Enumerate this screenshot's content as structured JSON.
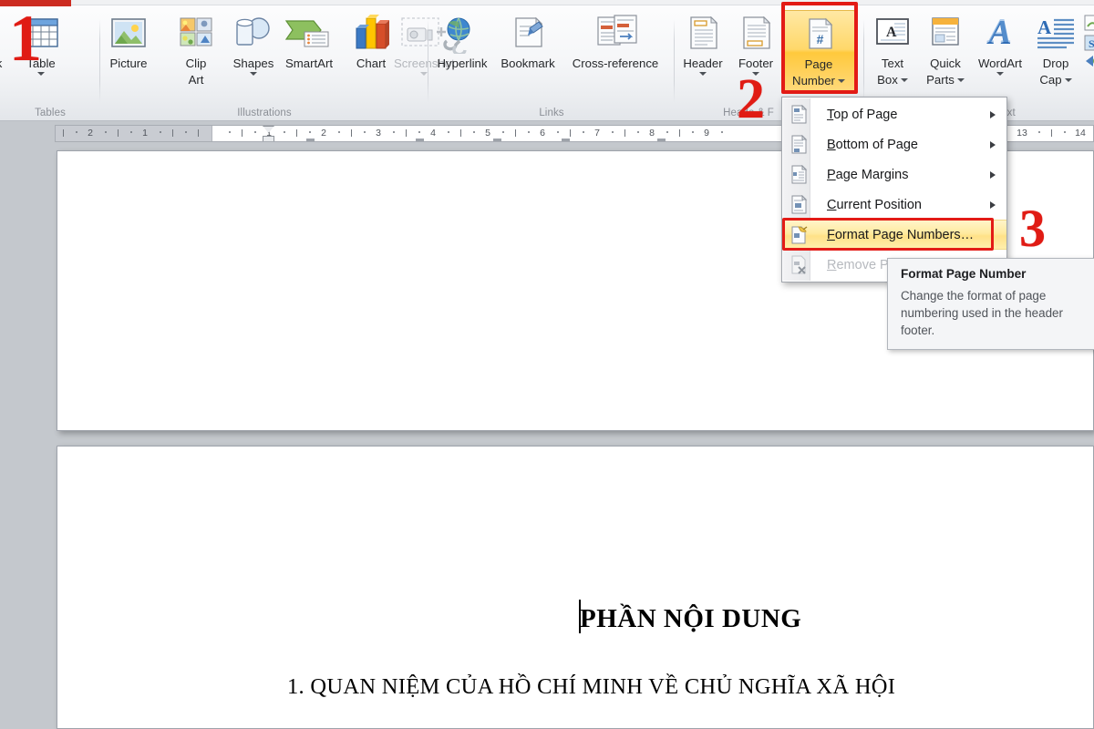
{
  "ribbon": {
    "groups": [
      {
        "name": "tables",
        "title": "Tables"
      },
      {
        "name": "illustrations",
        "title": "Illustrations"
      },
      {
        "name": "links",
        "title": "Links"
      },
      {
        "name": "header_footer",
        "title": "Heade  & F"
      },
      {
        "name": "text",
        "title": "Text"
      }
    ],
    "buttons": {
      "table": "Table",
      "picture": "Picture",
      "clip_art_line1": "Clip",
      "clip_art_line2": "Art",
      "shapes": "Shapes",
      "smartart": "SmartArt",
      "chart": "Chart",
      "screenshot": "Screenshot",
      "hyperlink": "Hyperlink",
      "bookmark": "Bookmark",
      "cross_reference": "Cross-reference",
      "header": "Header",
      "footer": "Footer",
      "page_number_line1": "Page",
      "page_number_line2": "Number",
      "text_box_line1": "Text",
      "text_box_line2": "Box",
      "quick_parts_line1": "Quick",
      "quick_parts_line2": "Parts",
      "wordart": "WordArt",
      "drop_cap_line1": "Drop",
      "drop_cap_line2": "Cap"
    },
    "highlight_color": "#ffd86a",
    "annotation_color": "#e31b16"
  },
  "ruler": {
    "left_margin_ticks": [
      "2",
      "1"
    ],
    "ticks": [
      "1",
      "2",
      "3",
      "4",
      "5",
      "6",
      "7",
      "8",
      "9",
      "13",
      "14"
    ]
  },
  "menu": {
    "name": "page-number-menu",
    "items": [
      {
        "label": "Top of Page",
        "underline": "T",
        "submenu": true,
        "state": "normal",
        "icon": "page-top-number-icon"
      },
      {
        "label": "Bottom of Page",
        "underline": "B",
        "submenu": true,
        "state": "normal",
        "icon": "page-bottom-number-icon"
      },
      {
        "label": "Page Margins",
        "underline": "P",
        "submenu": true,
        "state": "normal",
        "icon": "page-margins-number-icon"
      },
      {
        "label": "Current Position",
        "underline": "C",
        "submenu": true,
        "state": "normal",
        "icon": "page-current-position-icon"
      },
      {
        "label": "Format Page Numbers…",
        "underline": "F",
        "submenu": false,
        "state": "highlighted",
        "icon": "format-page-number-icon"
      },
      {
        "label": "Remove P",
        "underline": "R",
        "submenu": false,
        "state": "disabled",
        "icon": "remove-page-number-icon"
      }
    ]
  },
  "tooltip": {
    "title": "Format Page Number",
    "body": "Change the format of page numbering used in the header footer."
  },
  "document": {
    "heading": "PHẦN NỘI DUNG",
    "item_1": "1.  QUAN NIỆM CỦA HỒ CHÍ MINH VỀ CHỦ NGHĨA XÃ HỘI"
  },
  "annotations": {
    "step_1": "1",
    "step_2": "2",
    "step_3": "3"
  }
}
